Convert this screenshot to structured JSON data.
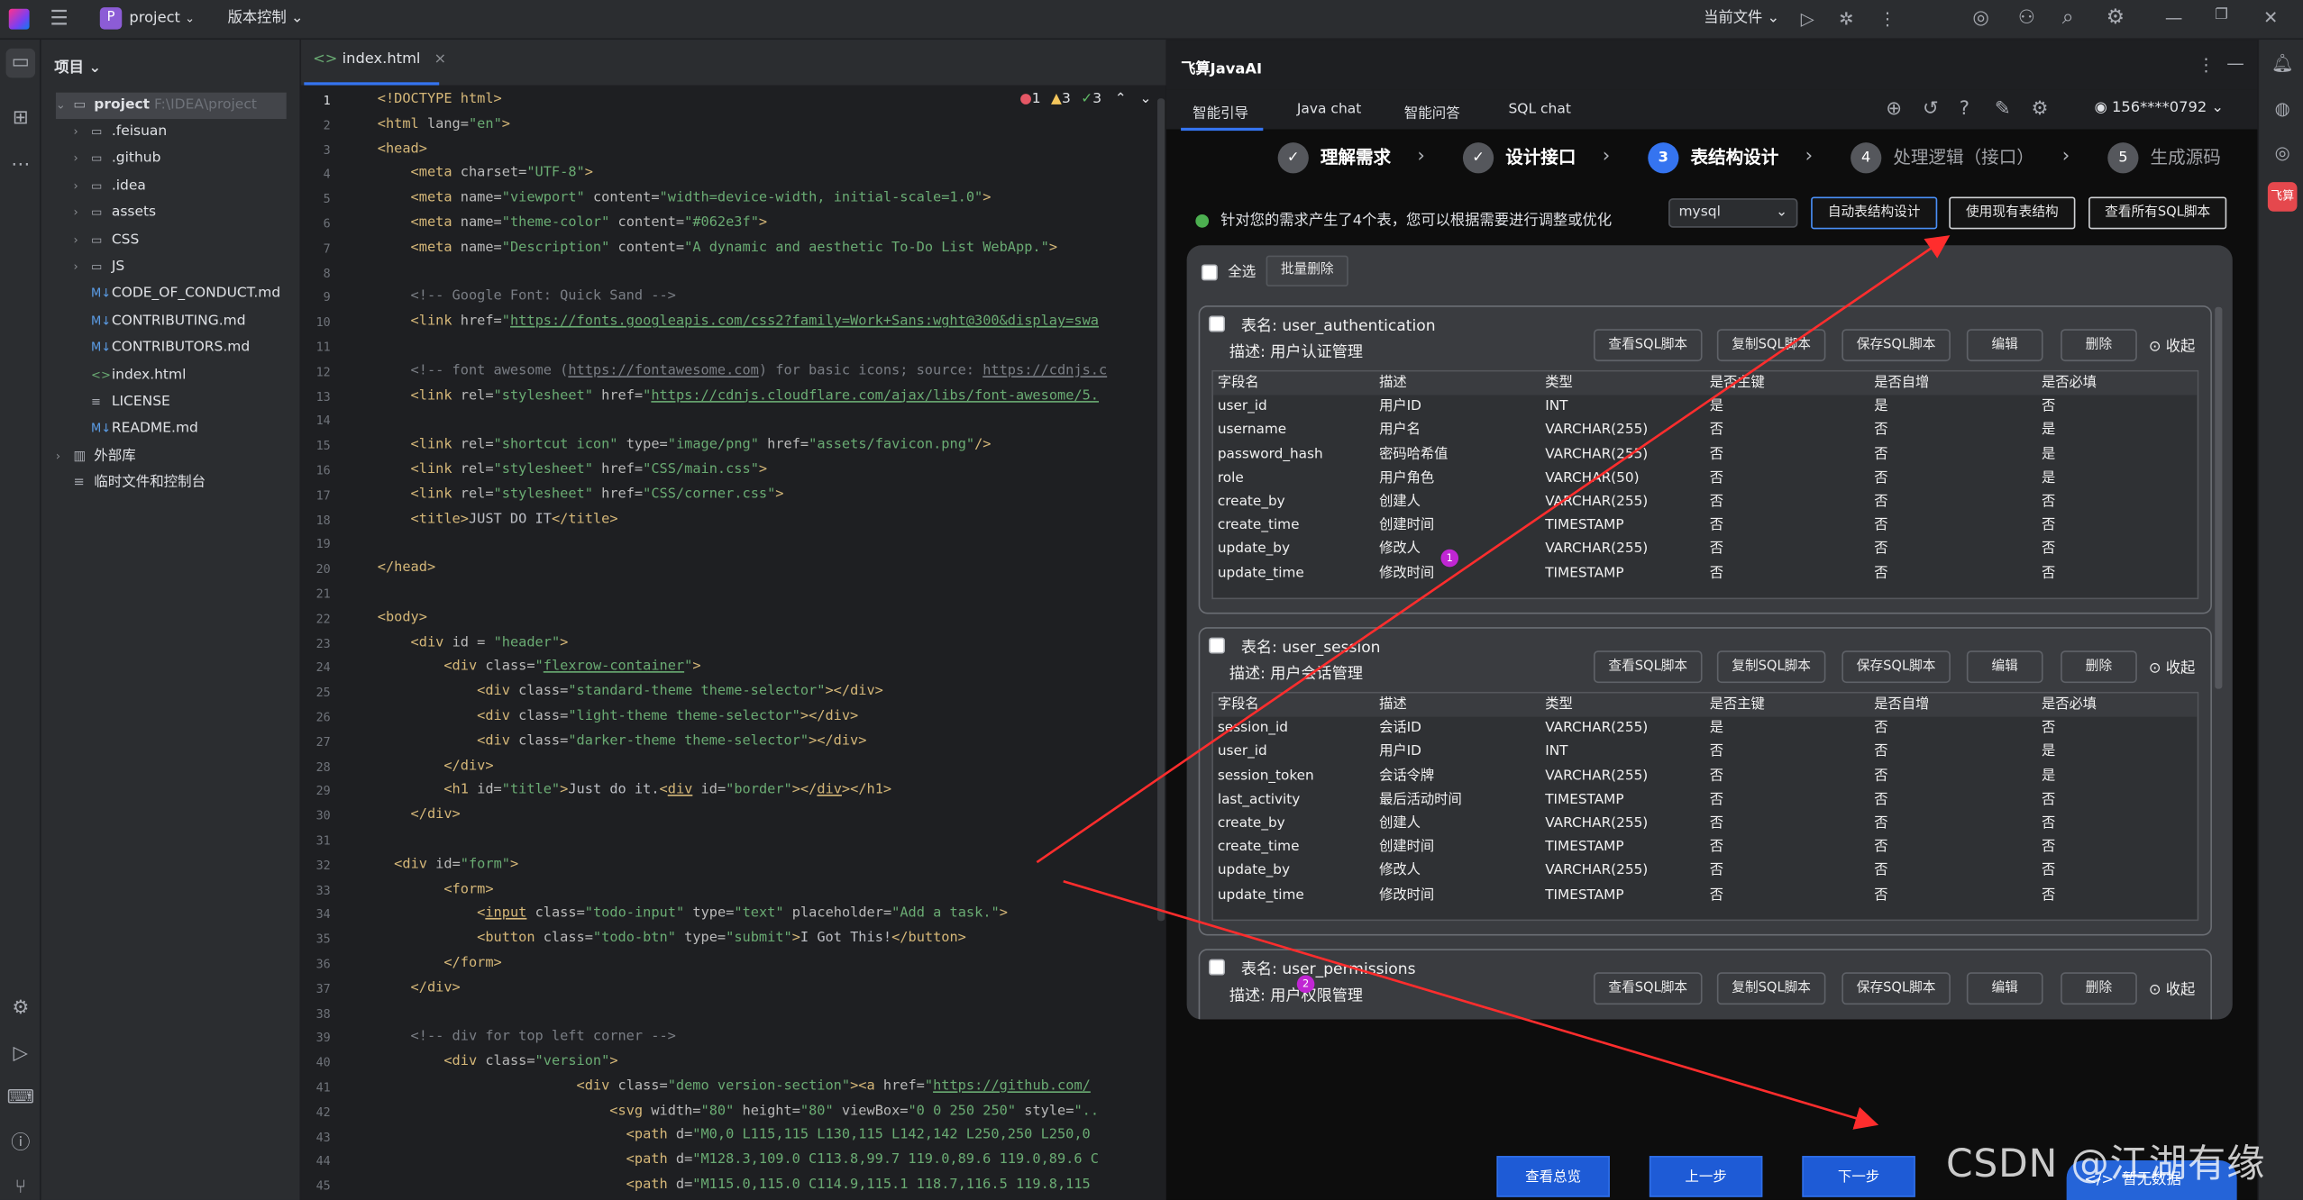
{
  "titlebar": {
    "project": "project",
    "project_badge": "P",
    "vcs": "版本控制 ⌄",
    "current_file": "当前文件 ⌄"
  },
  "project_panel": {
    "header": "项目 ⌄",
    "root_name": "project",
    "root_path": "F:\\IDEA\\project",
    "items": [
      {
        "label": ".feisuan",
        "icon": "folder"
      },
      {
        "label": ".github",
        "icon": "folder"
      },
      {
        "label": ".idea",
        "icon": "folder"
      },
      {
        "label": "assets",
        "icon": "folder"
      },
      {
        "label": "CSS",
        "icon": "folder"
      },
      {
        "label": "JS",
        "icon": "folder"
      },
      {
        "label": "CODE_OF_CONDUCT.md",
        "icon": "markdown"
      },
      {
        "label": "CONTRIBUTING.md",
        "icon": "markdown"
      },
      {
        "label": "CONTRIBUTORS.md",
        "icon": "markdown"
      },
      {
        "label": "index.html",
        "icon": "html"
      },
      {
        "label": "LICENSE",
        "icon": "text"
      },
      {
        "label": "README.md",
        "icon": "markdown"
      }
    ],
    "external_libs": "外部库",
    "scratches": "临时文件和控制台"
  },
  "editor": {
    "tab": "index.html",
    "inspections": {
      "errors": "1",
      "warnings": "3",
      "ok": "3"
    },
    "line_numbers": [
      "1",
      "2",
      "3",
      "4",
      "5",
      "6",
      "7",
      "8",
      "9",
      "10",
      "11",
      "12",
      "13",
      "14",
      "15",
      "16",
      "17",
      "18",
      "19",
      "20",
      "21",
      "22",
      "23",
      "24",
      "25",
      "26",
      "27",
      "28",
      "29",
      "30",
      "31",
      "32",
      "33",
      "34",
      "35",
      "36",
      "37",
      "38",
      "39",
      "40",
      "41",
      "42",
      "43",
      "44",
      "45"
    ]
  },
  "ai": {
    "title": "飞算JavaAI",
    "nav": [
      "智能引导",
      "Java chat",
      "智能问答",
      "SQL chat"
    ],
    "user": "156****0792",
    "steps": [
      {
        "num": "✓",
        "label": "理解需求",
        "state": "done"
      },
      {
        "num": "✓",
        "label": "设计接口",
        "state": "done"
      },
      {
        "num": "3",
        "label": "表结构设计",
        "state": "active"
      },
      {
        "num": "4",
        "label": "处理逻辑（接口）",
        "state": "pending"
      },
      {
        "num": "5",
        "label": "生成源码",
        "state": "pending"
      }
    ],
    "info": "针对您的需求产生了4个表，您可以根据需要进行调整或优化",
    "db": "mysql",
    "top_buttons": [
      "自动表结构设计",
      "使用现有表结构",
      "查看所有SQL脚本"
    ],
    "select_all": "全选",
    "batch_delete": "批量删除",
    "card_buttons": [
      "查看SQL脚本",
      "复制SQL脚本",
      "保存SQL脚本",
      "编辑",
      "删除"
    ],
    "collapse": "收起",
    "columns": [
      "字段名",
      "描述",
      "类型",
      "是否主键",
      "是否自增",
      "是否必填"
    ],
    "tables": [
      {
        "title": "表名: user_authentication",
        "desc": "描述: 用户认证管理",
        "rows": [
          [
            "user_id",
            "用户ID",
            "INT",
            "是",
            "是",
            "否"
          ],
          [
            "username",
            "用户名",
            "VARCHAR(255)",
            "否",
            "否",
            "是"
          ],
          [
            "password_hash",
            "密码哈希值",
            "VARCHAR(255)",
            "否",
            "否",
            "是"
          ],
          [
            "role",
            "用户角色",
            "VARCHAR(50)",
            "否",
            "否",
            "是"
          ],
          [
            "create_by",
            "创建人",
            "VARCHAR(255)",
            "否",
            "否",
            "否"
          ],
          [
            "create_time",
            "创建时间",
            "TIMESTAMP",
            "否",
            "否",
            "否"
          ],
          [
            "update_by",
            "修改人",
            "VARCHAR(255)",
            "否",
            "否",
            "否"
          ],
          [
            "update_time",
            "修改时间",
            "TIMESTAMP",
            "否",
            "否",
            "否"
          ]
        ]
      },
      {
        "title": "表名: user_session",
        "desc": "描述: 用户会话管理",
        "rows": [
          [
            "session_id",
            "会话ID",
            "VARCHAR(255)",
            "是",
            "否",
            "否"
          ],
          [
            "user_id",
            "用户ID",
            "INT",
            "否",
            "否",
            "是"
          ],
          [
            "session_token",
            "会话令牌",
            "VARCHAR(255)",
            "否",
            "否",
            "是"
          ],
          [
            "last_activity",
            "最后活动时间",
            "TIMESTAMP",
            "否",
            "否",
            "否"
          ],
          [
            "create_by",
            "创建人",
            "VARCHAR(255)",
            "否",
            "否",
            "否"
          ],
          [
            "create_time",
            "创建时间",
            "TIMESTAMP",
            "否",
            "否",
            "否"
          ],
          [
            "update_by",
            "修改人",
            "VARCHAR(255)",
            "否",
            "否",
            "否"
          ],
          [
            "update_time",
            "修改时间",
            "TIMESTAMP",
            "否",
            "否",
            "否"
          ]
        ]
      },
      {
        "title": "表名: user_permissions",
        "desc": "描述: 用户权限管理",
        "rows": []
      }
    ],
    "bottom_buttons": [
      "查看总览",
      "上一步",
      "下一步"
    ],
    "markers": [
      "1",
      "2"
    ]
  },
  "watermark": "CSDN @江湖有缘",
  "toast": "暂无数据"
}
